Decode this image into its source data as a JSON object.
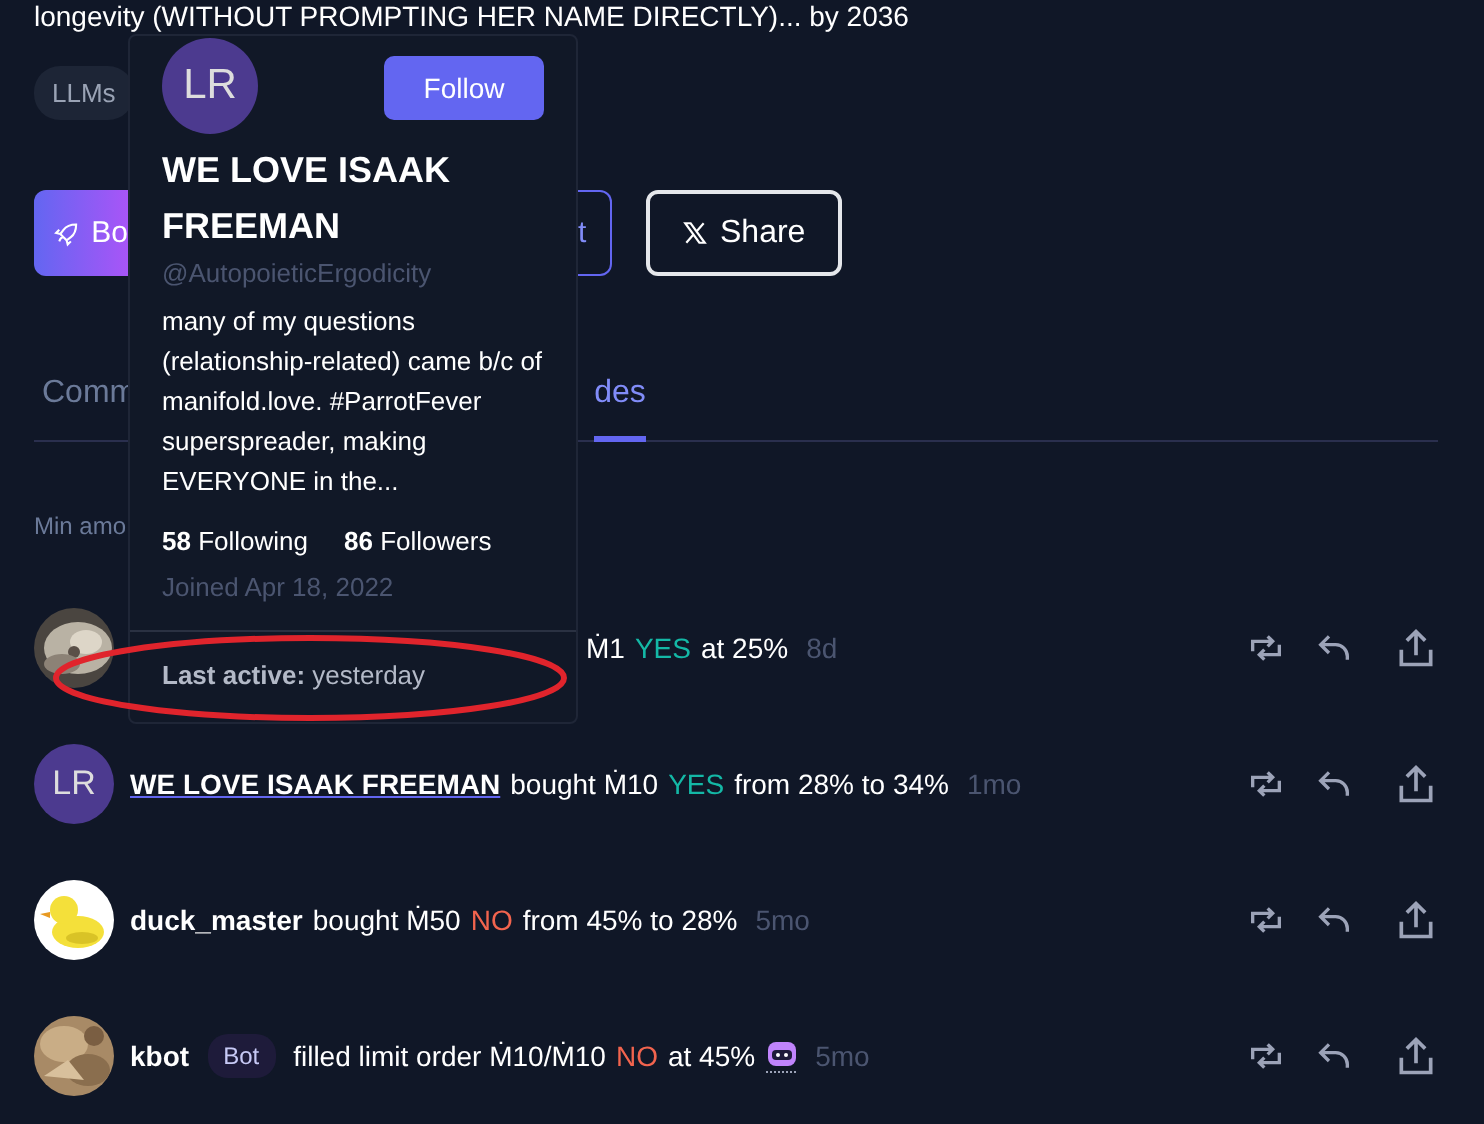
{
  "title": "longevity (WITHOUT PROMPTING HER NAME DIRECTLY)... by 2036",
  "tags": [
    "LLMs"
  ],
  "actions": {
    "boost": "Bo",
    "outline": "t",
    "share": "Share"
  },
  "tabs": [
    {
      "label": "Comm",
      "selected": false
    },
    {
      "label": "des",
      "selected": true
    }
  ],
  "filter_label": "Min amo",
  "trades": [
    {
      "amount": "Ṁ1",
      "outcome": "YES",
      "detail": "at 25%",
      "time": "8d"
    },
    {
      "avatar": {
        "kind": "initials",
        "initials": "LR"
      },
      "user": "WE LOVE ISAAK FREEMAN",
      "link": true,
      "action": "bought Ṁ10",
      "outcome": "YES",
      "detail": "from 28% to 34%",
      "time": "1mo"
    },
    {
      "avatar": {
        "kind": "duck"
      },
      "user": "duck_master",
      "link": false,
      "action": "bought Ṁ50",
      "outcome": "NO",
      "detail": "from 45% to 28%",
      "time": "5mo"
    },
    {
      "user": "kbot",
      "link": false,
      "badge": "Bot",
      "action": "filled limit order Ṁ10/Ṁ10",
      "outcome": "NO",
      "detail": "at 45%",
      "robot": true,
      "time": "5mo"
    }
  ],
  "popover": {
    "initials": "LR",
    "follow": "Follow",
    "name": "WE LOVE ISAAK FREEMAN",
    "handle": "@AutopoieticErgodicity",
    "bio": "many of my questions (relationship-related) came b/c of manifold.love. #ParrotFever superspreader, making EVERYONE in the...",
    "following_count": "58",
    "following_label": "Following",
    "followers_count": "86",
    "followers_label": "Followers",
    "joined": "Joined Apr 18, 2022",
    "last_active_label": "Last active:",
    "last_active": "yesterday"
  }
}
